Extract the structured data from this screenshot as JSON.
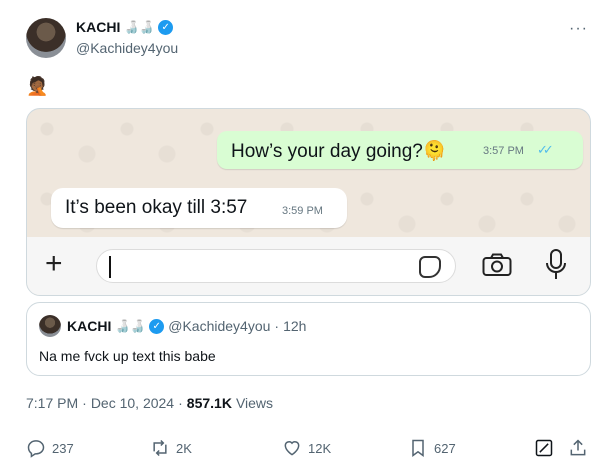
{
  "header": {
    "name": "KACHI",
    "name_emoji": "🍶🍶",
    "handle": "@Kachidey4you",
    "more": "···"
  },
  "tweet": {
    "emoji": "🤦🏾"
  },
  "chat": {
    "outgoing": {
      "text": "How’s your day going?🫠",
      "time": "3:57 PM"
    },
    "incoming": {
      "text": "It’s been okay till 3:57",
      "time": "3:59 PM"
    }
  },
  "quote": {
    "name": "KACHI",
    "name_emoji": "🍶🍶",
    "handle": "@Kachidey4you",
    "dot": "·",
    "time": "12h",
    "text": "Na me fvck up text this babe"
  },
  "meta": {
    "time": "7:17 PM",
    "sep1": "·",
    "date": "Dec 10, 2024",
    "sep2": "·",
    "views_count": "857.1K",
    "views_label": "Views"
  },
  "actions": {
    "replies": "237",
    "reposts": "2K",
    "likes": "12K",
    "bookmarks": "627"
  },
  "colors": {
    "accent": "#1d9bf0",
    "bubble_out": "#d9fdd3",
    "chat_bg": "#efe7dd",
    "read_ticks": "#53bdeb"
  }
}
